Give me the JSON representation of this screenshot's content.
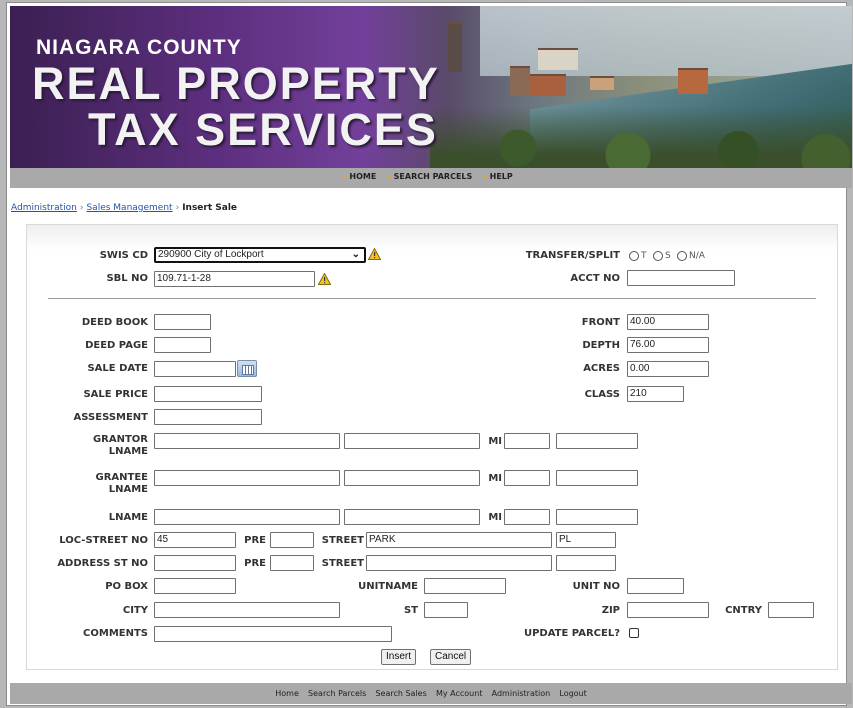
{
  "banner": {
    "line1": "NIAGARA COUNTY",
    "line2": "REAL PROPERTY",
    "line3": "TAX SERVICES"
  },
  "nav": {
    "home": "HOME",
    "search_parcels": "SEARCH PARCELS",
    "help": "HELP"
  },
  "breadcrumb": {
    "admin": "Administration",
    "sales": "Sales Management",
    "current": "Insert Sale"
  },
  "form": {
    "swis_cd": {
      "label": "SWIS CD",
      "value": "290900 City of Lockport"
    },
    "sbl_no": {
      "label": "SBL NO",
      "value": "109.71-1-28"
    },
    "transfer_split": {
      "label": "TRANSFER/SPLIT",
      "options": [
        "T",
        "S",
        "N/A"
      ]
    },
    "acct_no": {
      "label": "ACCT NO",
      "value": ""
    },
    "deed_book": {
      "label": "DEED BOOK",
      "value": ""
    },
    "deed_page": {
      "label": "DEED PAGE",
      "value": ""
    },
    "sale_date": {
      "label": "SALE DATE",
      "value": ""
    },
    "sale_price": {
      "label": "SALE PRICE",
      "value": ""
    },
    "assessment": {
      "label": "ASSESSMENT",
      "value": ""
    },
    "front": {
      "label": "FRONT",
      "value": "40.00"
    },
    "depth": {
      "label": "DEPTH",
      "value": "76.00"
    },
    "acres": {
      "label": "ACRES",
      "value": "0.00"
    },
    "class": {
      "label": "CLASS",
      "value": "210"
    },
    "grantor": {
      "label": "GRANTOR LNAME",
      "mi_label": "MI"
    },
    "grantee": {
      "label": "GRANTEE LNAME",
      "mi_label": "MI"
    },
    "lname": {
      "label": "LNAME",
      "mi_label": "MI"
    },
    "loc_street": {
      "label": "LOC-STREET NO",
      "value": "45",
      "pre_label": "PRE",
      "street_label": "STREET",
      "street_value": "PARK",
      "suffix_value": "PL"
    },
    "address_st": {
      "label": "ADDRESS ST NO",
      "pre_label": "PRE",
      "street_label": "STREET"
    },
    "po_box": {
      "label": "PO BOX"
    },
    "unitname": {
      "label": "UNITNAME"
    },
    "unit_no": {
      "label": "UNIT NO"
    },
    "city": {
      "label": "CITY"
    },
    "st": {
      "label": "ST"
    },
    "zip": {
      "label": "ZIP"
    },
    "cntry": {
      "label": "CNTRY"
    },
    "comments": {
      "label": "COMMENTS"
    },
    "update_parcel": {
      "label": "UPDATE PARCEL?"
    },
    "insert_label": "Insert",
    "cancel_label": "Cancel"
  },
  "footer": {
    "links": [
      "Home",
      "Search Parcels",
      "Search Sales",
      "My Account",
      "Administration",
      "Logout"
    ]
  },
  "colors": {
    "banner_purple": "#5d2f7f",
    "nav_gray": "#a9a9a9",
    "link_blue": "#2255aa",
    "warn_yellow": "#f2c12e"
  }
}
